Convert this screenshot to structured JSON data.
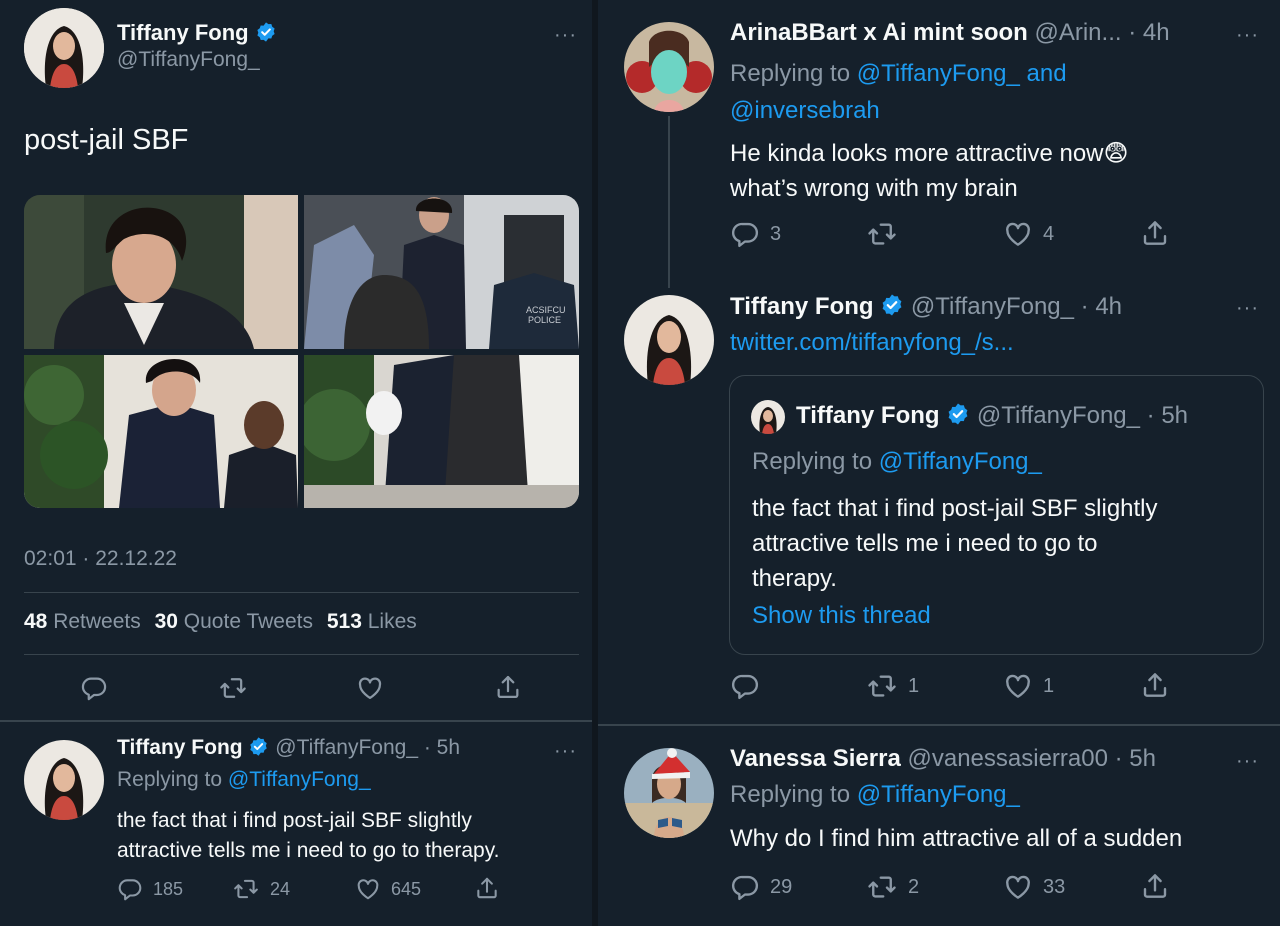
{
  "main_tweet": {
    "author_name": "Tiffany Fong",
    "handle": "@TiffanyFong_",
    "text": "post-jail SBF",
    "timestamp": "02:01 · 22.12.22",
    "retweets_count": "48",
    "retweets_label": "Retweets",
    "quotes_count": "30",
    "quotes_label": "Quote Tweets",
    "likes_count": "513",
    "likes_label": "Likes",
    "photo_text": "ACSIFCU\nPOLICE"
  },
  "left_reply": {
    "author_name": "Tiffany Fong",
    "handle_time": "@TiffanyFong_ · 5h",
    "replying_prefix": "Replying to ",
    "replying_to": "@TiffanyFong_",
    "text_line1": "the fact that i find post-jail SBF slightly",
    "text_line2": "attractive tells me i need to go to therapy.",
    "replies": "185",
    "retweets": "24",
    "likes": "645"
  },
  "reply1": {
    "author_name": "ArinaBBart x Ai mint soon",
    "handle_time": "@Arin... · 4h",
    "replying_prefix": "Replying to ",
    "replying_to": "@TiffanyFong_ and",
    "replying_to2": "@inversebrah",
    "text_line1": "He kinda looks more attractive now😨",
    "text_line2": "what’s wrong with my brain",
    "replies": "3",
    "retweets": "",
    "likes": "4"
  },
  "reply2": {
    "author_name": "Tiffany Fong",
    "handle_time": "@TiffanyFong_ · 4h",
    "link_text": "twitter.com/tiffanyfong_/s...",
    "quoted": {
      "author_name": "Tiffany Fong",
      "handle_time": "@TiffanyFong_ · 5h",
      "replying_prefix": "Replying to ",
      "replying_to": "@TiffanyFong_",
      "text_line1": "the fact that i find post-jail SBF slightly",
      "text_line2": "attractive tells me i need to go to",
      "text_line3": "therapy.",
      "show_thread": "Show this thread"
    },
    "replies": "",
    "retweets": "1",
    "likes": "1"
  },
  "reply3": {
    "author_name": "Vanessa Sierra",
    "handle_time": "@vanessasierra00 · 5h",
    "replying_prefix": "Replying to ",
    "replying_to": "@TiffanyFong_",
    "text": "Why do I find him attractive all of a sudden",
    "replies": "29",
    "retweets": "2",
    "likes": "33"
  },
  "more_glyph": "···",
  "colors": {
    "background": "#15202b",
    "link": "#1d9bf0",
    "muted": "#8b98a5",
    "verified": "#1d9bf0",
    "border": "#38444d"
  }
}
